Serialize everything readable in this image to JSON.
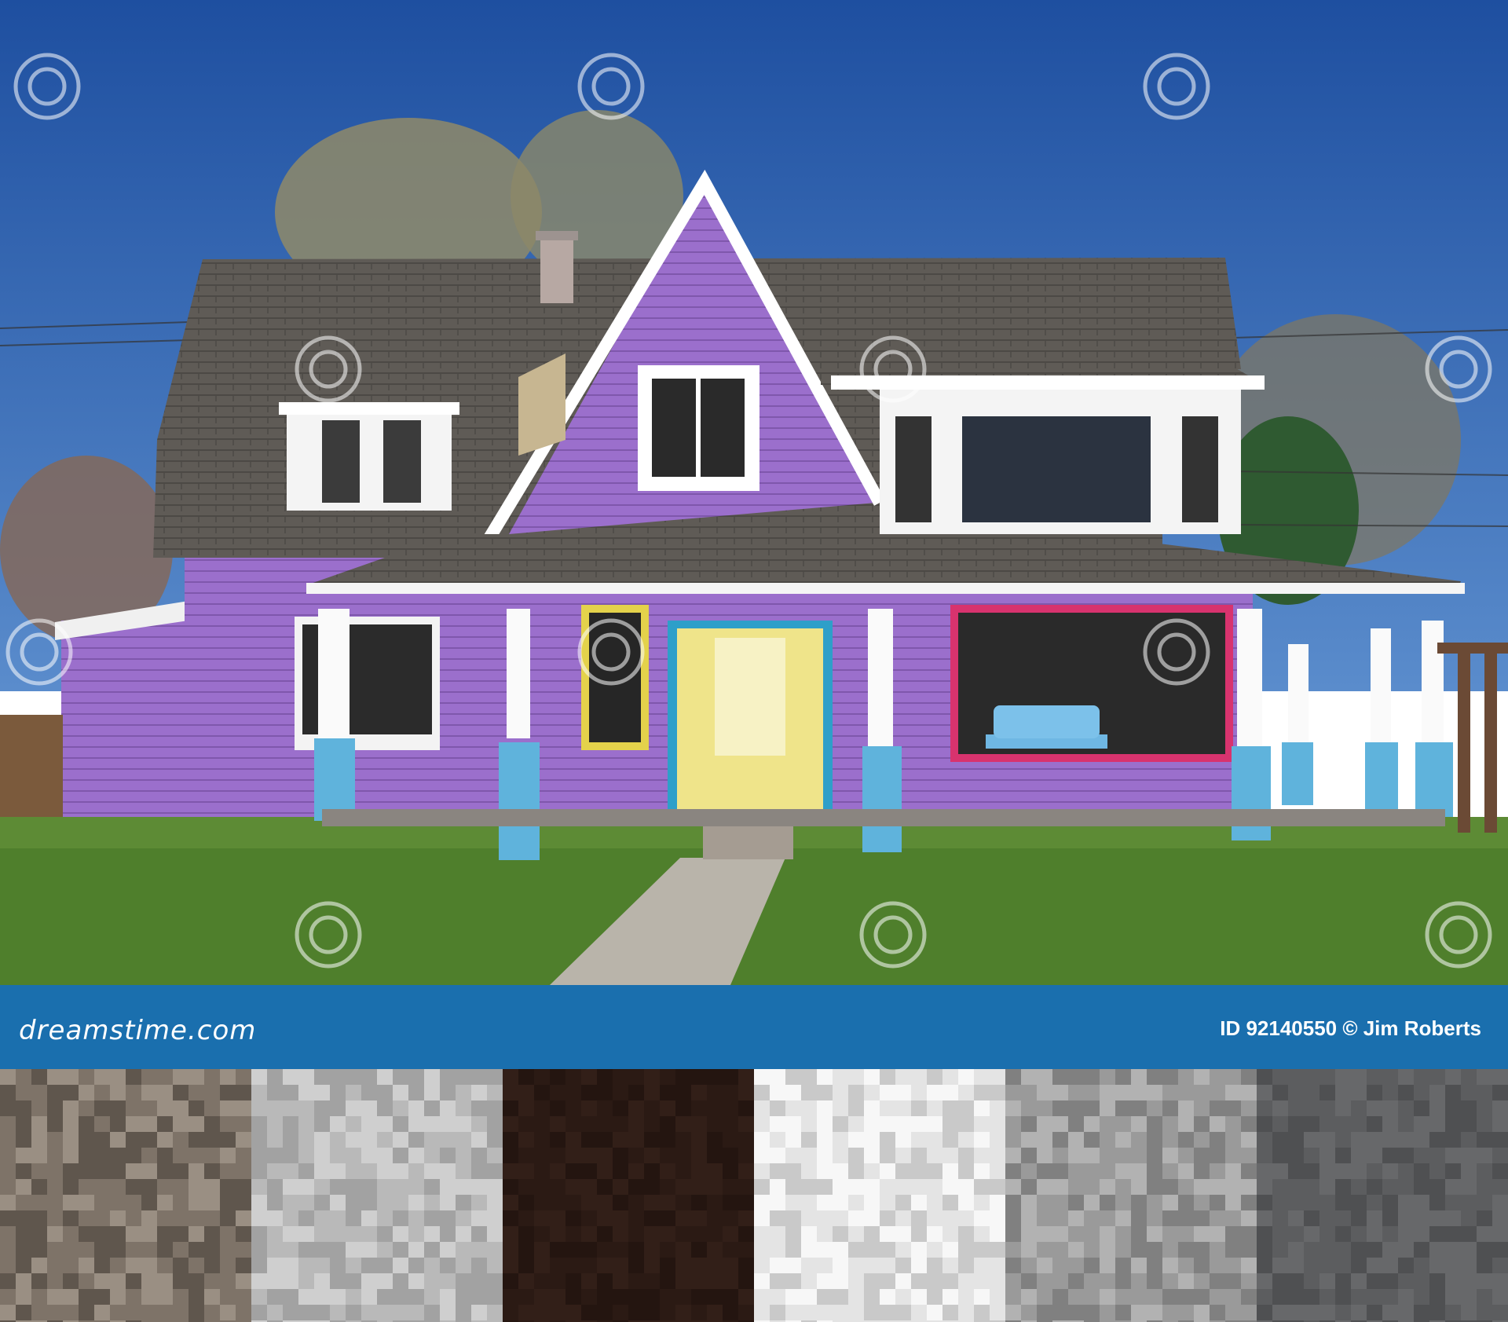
{
  "banner": {
    "brand": "dreamstime.com",
    "credit": "ID 92140550 © Jim Roberts",
    "color": "#1a6fae"
  },
  "photo": {
    "subject": "purple-house",
    "watermark_text": "dreamstime",
    "colors": {
      "sky": "#2d5fa8",
      "siding": "#9a6ecb",
      "roof": "#5e5a55",
      "trim": "#f4f4f4",
      "pillar_base": "#5fb3dc",
      "door": "#efe48a",
      "lawn": "#4f7f2c"
    }
  },
  "palette": {
    "swatches": [
      {
        "name": "taupe-swatch",
        "base": "#7e7368",
        "light": "#9a8f83",
        "dark": "#5f564d"
      },
      {
        "name": "light-gray-swatch",
        "base": "#b9b9b9",
        "light": "#cfcfcf",
        "dark": "#a2a2a2"
      },
      {
        "name": "dark-brown-swatch",
        "base": "#2b1a14",
        "light": "#321f18",
        "dark": "#241510"
      },
      {
        "name": "white-swatch",
        "base": "#e4e4e4",
        "light": "#f7f7f7",
        "dark": "#c9c9c9"
      },
      {
        "name": "mid-gray-swatch",
        "base": "#9a9a9a",
        "light": "#b2b2b2",
        "dark": "#808080"
      },
      {
        "name": "slate-gray-swatch",
        "base": "#5c5d5f",
        "light": "#67686a",
        "dark": "#4f5052"
      }
    ]
  }
}
